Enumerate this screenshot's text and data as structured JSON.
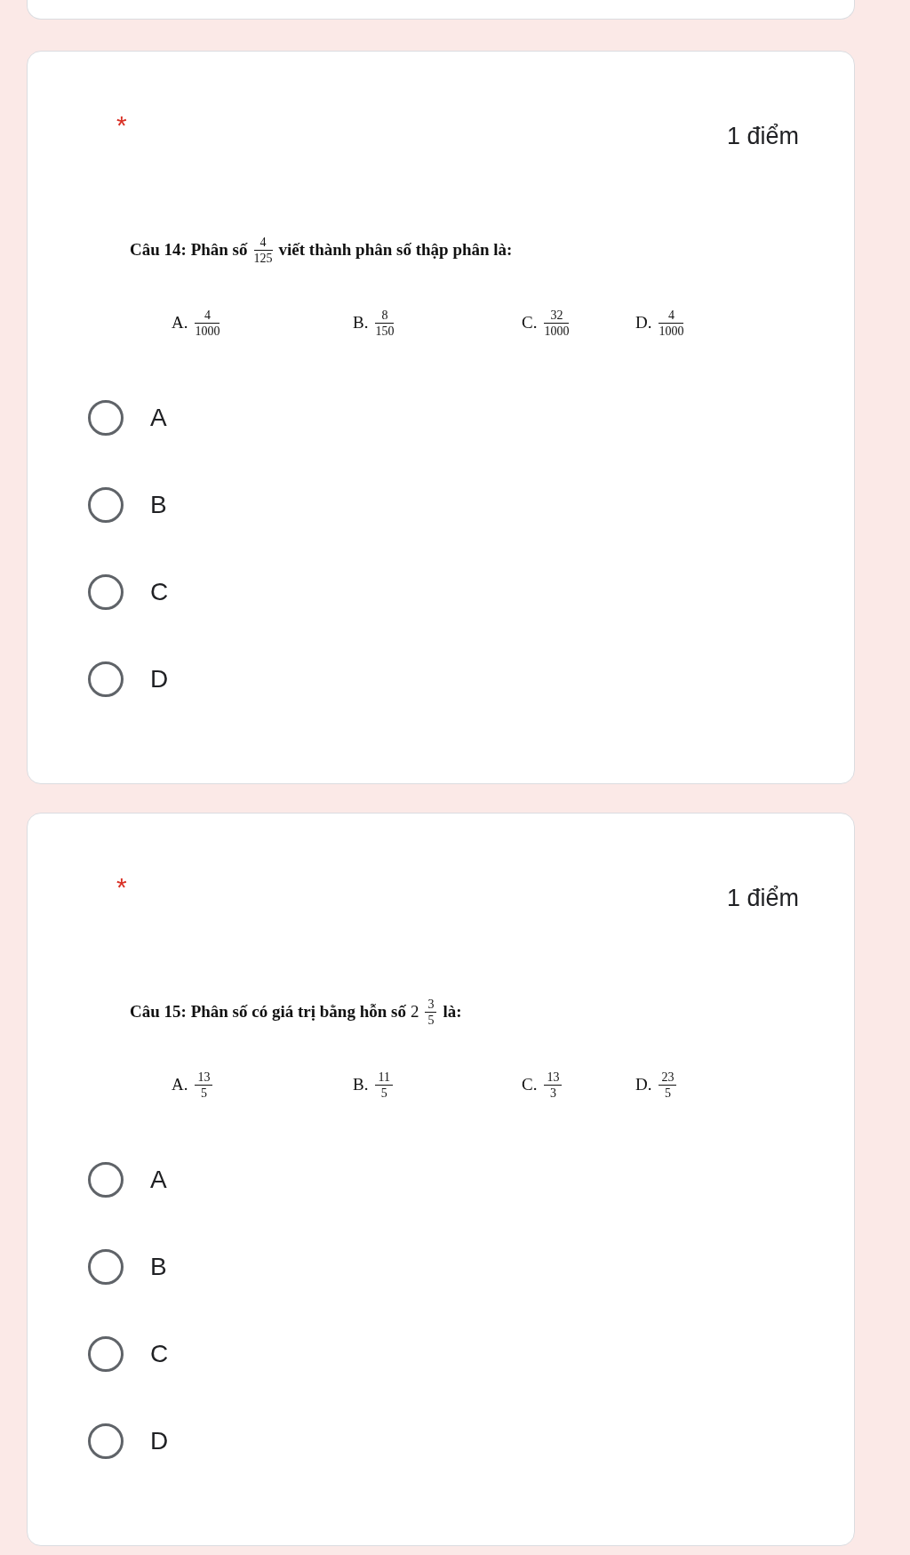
{
  "questions": [
    {
      "required_mark": "*",
      "points": "1 điểm",
      "prompt": {
        "label": "Câu 14:",
        "before": "Phân số",
        "fraction": {
          "num": "4",
          "den": "125"
        },
        "after": "viết thành phân số thập phân là:"
      },
      "choices": [
        {
          "letter": "A.",
          "num": "4",
          "den": "1000"
        },
        {
          "letter": "B.",
          "num": "8",
          "den": "150"
        },
        {
          "letter": "C.",
          "num": "32",
          "den": "1000"
        },
        {
          "letter": "D.",
          "num": "4",
          "den": "1000"
        }
      ],
      "options": [
        {
          "label": "A",
          "selected": false
        },
        {
          "label": "B",
          "selected": false
        },
        {
          "label": "C",
          "selected": false
        },
        {
          "label": "D",
          "selected": false
        }
      ]
    },
    {
      "required_mark": "*",
      "points": "1 điểm",
      "prompt": {
        "label": "Câu 15:",
        "before": "Phân số có giá trị bằng hỗn số",
        "whole": "2",
        "fraction": {
          "num": "3",
          "den": "5"
        },
        "after": "là:"
      },
      "choices": [
        {
          "letter": "A.",
          "num": "13",
          "den": "5"
        },
        {
          "letter": "B.",
          "num": "11",
          "den": "5"
        },
        {
          "letter": "C.",
          "num": "13",
          "den": "3"
        },
        {
          "letter": "D.",
          "num": "23",
          "den": "5"
        }
      ],
      "options": [
        {
          "label": "A",
          "selected": false
        },
        {
          "label": "B",
          "selected": false
        },
        {
          "label": "C",
          "selected": false
        },
        {
          "label": "D",
          "selected": false
        }
      ]
    }
  ]
}
